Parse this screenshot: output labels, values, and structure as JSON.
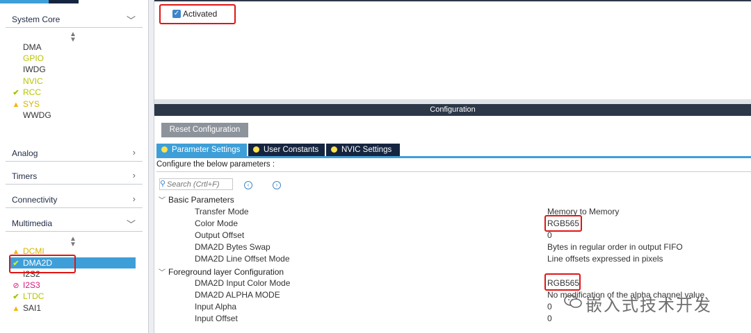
{
  "sidebar": {
    "categories": {
      "system_core": "System Core",
      "analog": "Analog",
      "timers": "Timers",
      "connectivity": "Connectivity",
      "multimedia": "Multimedia"
    },
    "system_core_items": [
      {
        "label": "DMA",
        "status": "none"
      },
      {
        "label": "GPIO",
        "status": "none"
      },
      {
        "label": "IWDG",
        "status": "none"
      },
      {
        "label": "NVIC",
        "status": "none"
      },
      {
        "label": "RCC",
        "status": "ok"
      },
      {
        "label": "SYS",
        "status": "warning"
      },
      {
        "label": "WWDG",
        "status": "none"
      }
    ],
    "multimedia_items": [
      {
        "label": "DCMI",
        "status": "warning"
      },
      {
        "label": "DMA2D",
        "status": "ok",
        "selected": true
      },
      {
        "label": "I2S2",
        "status": "none"
      },
      {
        "label": "I2S3",
        "status": "disabled"
      },
      {
        "label": "LTDC",
        "status": "ok"
      },
      {
        "label": "SAI1",
        "status": "warning"
      }
    ],
    "colors": {
      "selected_bg": "#3e9fd8",
      "ok": "#9ec400",
      "warning": "#f2b600",
      "disabled": "#d6177d"
    }
  },
  "mode": {
    "activated_label": "Activated",
    "activated_checked": true
  },
  "configuration": {
    "header": "Configuration",
    "reset_button": "Reset Configuration",
    "tabs": [
      {
        "label": "Parameter Settings",
        "active": true
      },
      {
        "label": "User Constants",
        "active": false
      },
      {
        "label": "NVIC Settings",
        "active": false
      }
    ],
    "instruction": "Configure the below parameters :",
    "search_placeholder": "Search (Crtl+F)",
    "sections": [
      {
        "title": "Basic Parameters",
        "params": [
          {
            "name": "Transfer Mode",
            "value": "Memory to Memory"
          },
          {
            "name": "Color Mode",
            "value": "RGB565"
          },
          {
            "name": "Output Offset",
            "value": "0"
          },
          {
            "name": "DMA2D Bytes Swap",
            "value": "Bytes in regular order in output FIFO"
          },
          {
            "name": "DMA2D Line Offset Mode",
            "value": "Line offsets expressed in pixels"
          }
        ]
      },
      {
        "title": "Foreground layer Configuration",
        "params": [
          {
            "name": "DMA2D Input Color Mode",
            "value": "RGB565"
          },
          {
            "name": "DMA2D ALPHA MODE",
            "value": "No modification of the alpha channel value"
          },
          {
            "name": "Input Alpha",
            "value": "0"
          },
          {
            "name": "Input Offset",
            "value": "0"
          }
        ]
      }
    ]
  },
  "watermark": {
    "text": "嵌入式技术开发"
  },
  "accent_colors": {
    "header_dark": "#2c3748",
    "tab_dark": "#16253f",
    "tab_active": "#3e9fd8",
    "highlight_red": "#e01414"
  }
}
